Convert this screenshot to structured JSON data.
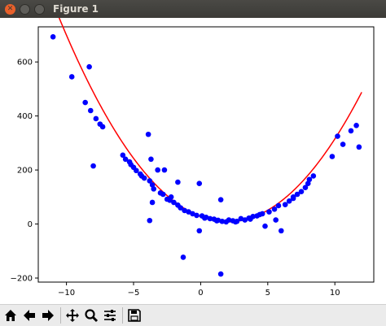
{
  "window": {
    "title": "Figure 1"
  },
  "toolbar": {
    "buttons": [
      "home-icon",
      "back-arrow-icon",
      "forward-arrow-icon",
      "pan-icon",
      "zoom-icon",
      "configure-subplots-icon",
      "save-icon"
    ]
  },
  "colors": {
    "points": "#0000ff",
    "fit_line": "#ff0000",
    "titlebar": "#3c3b37",
    "close": "#e9602a"
  },
  "chart_data": {
    "type": "scatter",
    "title": "",
    "xlabel": "",
    "ylabel": "",
    "xlim": [
      -12.1,
      12.9
    ],
    "ylim": [
      -215,
      730
    ],
    "xticks": [
      -10,
      -5,
      0,
      5,
      10
    ],
    "yticks": [
      -200,
      0,
      200,
      400,
      600
    ],
    "grid": false,
    "series": [
      {
        "kind": "scatter",
        "color": "#0000ff",
        "points": [
          [
            -11,
            693
          ],
          [
            -9.6,
            545
          ],
          [
            -8.6,
            450
          ],
          [
            -8.3,
            582
          ],
          [
            -8.2,
            420
          ],
          [
            -8,
            215
          ],
          [
            -7.8,
            390
          ],
          [
            -7.5,
            370
          ],
          [
            -7.3,
            360
          ],
          [
            -5.8,
            255
          ],
          [
            -5.6,
            240
          ],
          [
            -5.3,
            230
          ],
          [
            -5.0,
            210
          ],
          [
            -4.8,
            198
          ],
          [
            -4.5,
            185
          ],
          [
            -4.2,
            170
          ],
          [
            -3.9,
            332
          ],
          [
            -3.8,
            160
          ],
          [
            -3.7,
            240
          ],
          [
            -3.6,
            145
          ],
          [
            -3.5,
            130
          ],
          [
            -3.8,
            13
          ],
          [
            -3.6,
            80
          ],
          [
            -3.2,
            200
          ],
          [
            -3.0,
            115
          ],
          [
            -2.7,
            200
          ],
          [
            -2.5,
            92
          ],
          [
            -2.2,
            100
          ],
          [
            -2.0,
            80
          ],
          [
            -1.7,
            70
          ],
          [
            -1.5,
            60
          ],
          [
            -1.7,
            155
          ],
          [
            -1.2,
            50
          ],
          [
            -0.9,
            45
          ],
          [
            -0.6,
            38
          ],
          [
            -0.3,
            32
          ],
          [
            -0.1,
            150
          ],
          [
            -0.1,
            -25
          ],
          [
            0.1,
            30
          ],
          [
            0.4,
            25
          ],
          [
            0.7,
            20
          ],
          [
            1.0,
            18
          ],
          [
            1.3,
            14
          ],
          [
            1.5,
            90
          ],
          [
            1.6,
            10
          ],
          [
            1.9,
            8
          ],
          [
            2.1,
            15
          ],
          [
            2.4,
            12
          ],
          [
            2.7,
            10
          ],
          [
            3.0,
            20
          ],
          [
            3.3,
            15
          ],
          [
            3.6,
            22
          ],
          [
            3.9,
            28
          ],
          [
            4.2,
            30
          ],
          [
            4.6,
            38
          ],
          [
            4.8,
            -8
          ],
          [
            5.1,
            45
          ],
          [
            5.5,
            55
          ],
          [
            5.6,
            15
          ],
          [
            5.8,
            68
          ],
          [
            6.0,
            -25
          ],
          [
            6.3,
            72
          ],
          [
            6.6,
            85
          ],
          [
            6.9,
            95
          ],
          [
            7.2,
            110
          ],
          [
            7.5,
            120
          ],
          [
            7.8,
            135
          ],
          [
            8.0,
            150
          ],
          [
            8.4,
            178
          ],
          [
            -1.3,
            -123
          ],
          [
            1.5,
            -185
          ],
          [
            9.8,
            250
          ],
          [
            10.2,
            325
          ],
          [
            10.6,
            295
          ],
          [
            11.2,
            345
          ],
          [
            11.6,
            365
          ],
          [
            11.8,
            285
          ],
          [
            8.1,
            165
          ],
          [
            -5.2,
            220
          ],
          [
            -4.4,
            178
          ],
          [
            -2.8,
            110
          ],
          [
            -2.3,
            88
          ],
          [
            0.3,
            22
          ],
          [
            1.2,
            12
          ],
          [
            2.6,
            8
          ],
          [
            3.7,
            18
          ],
          [
            4.4,
            35
          ],
          [
            6.9,
            100
          ]
        ]
      },
      {
        "kind": "line",
        "color": "#ff0000",
        "formula": "y = 4.8*(x-2)^2 + 8",
        "x_range": [
          -11,
          12
        ]
      }
    ]
  }
}
